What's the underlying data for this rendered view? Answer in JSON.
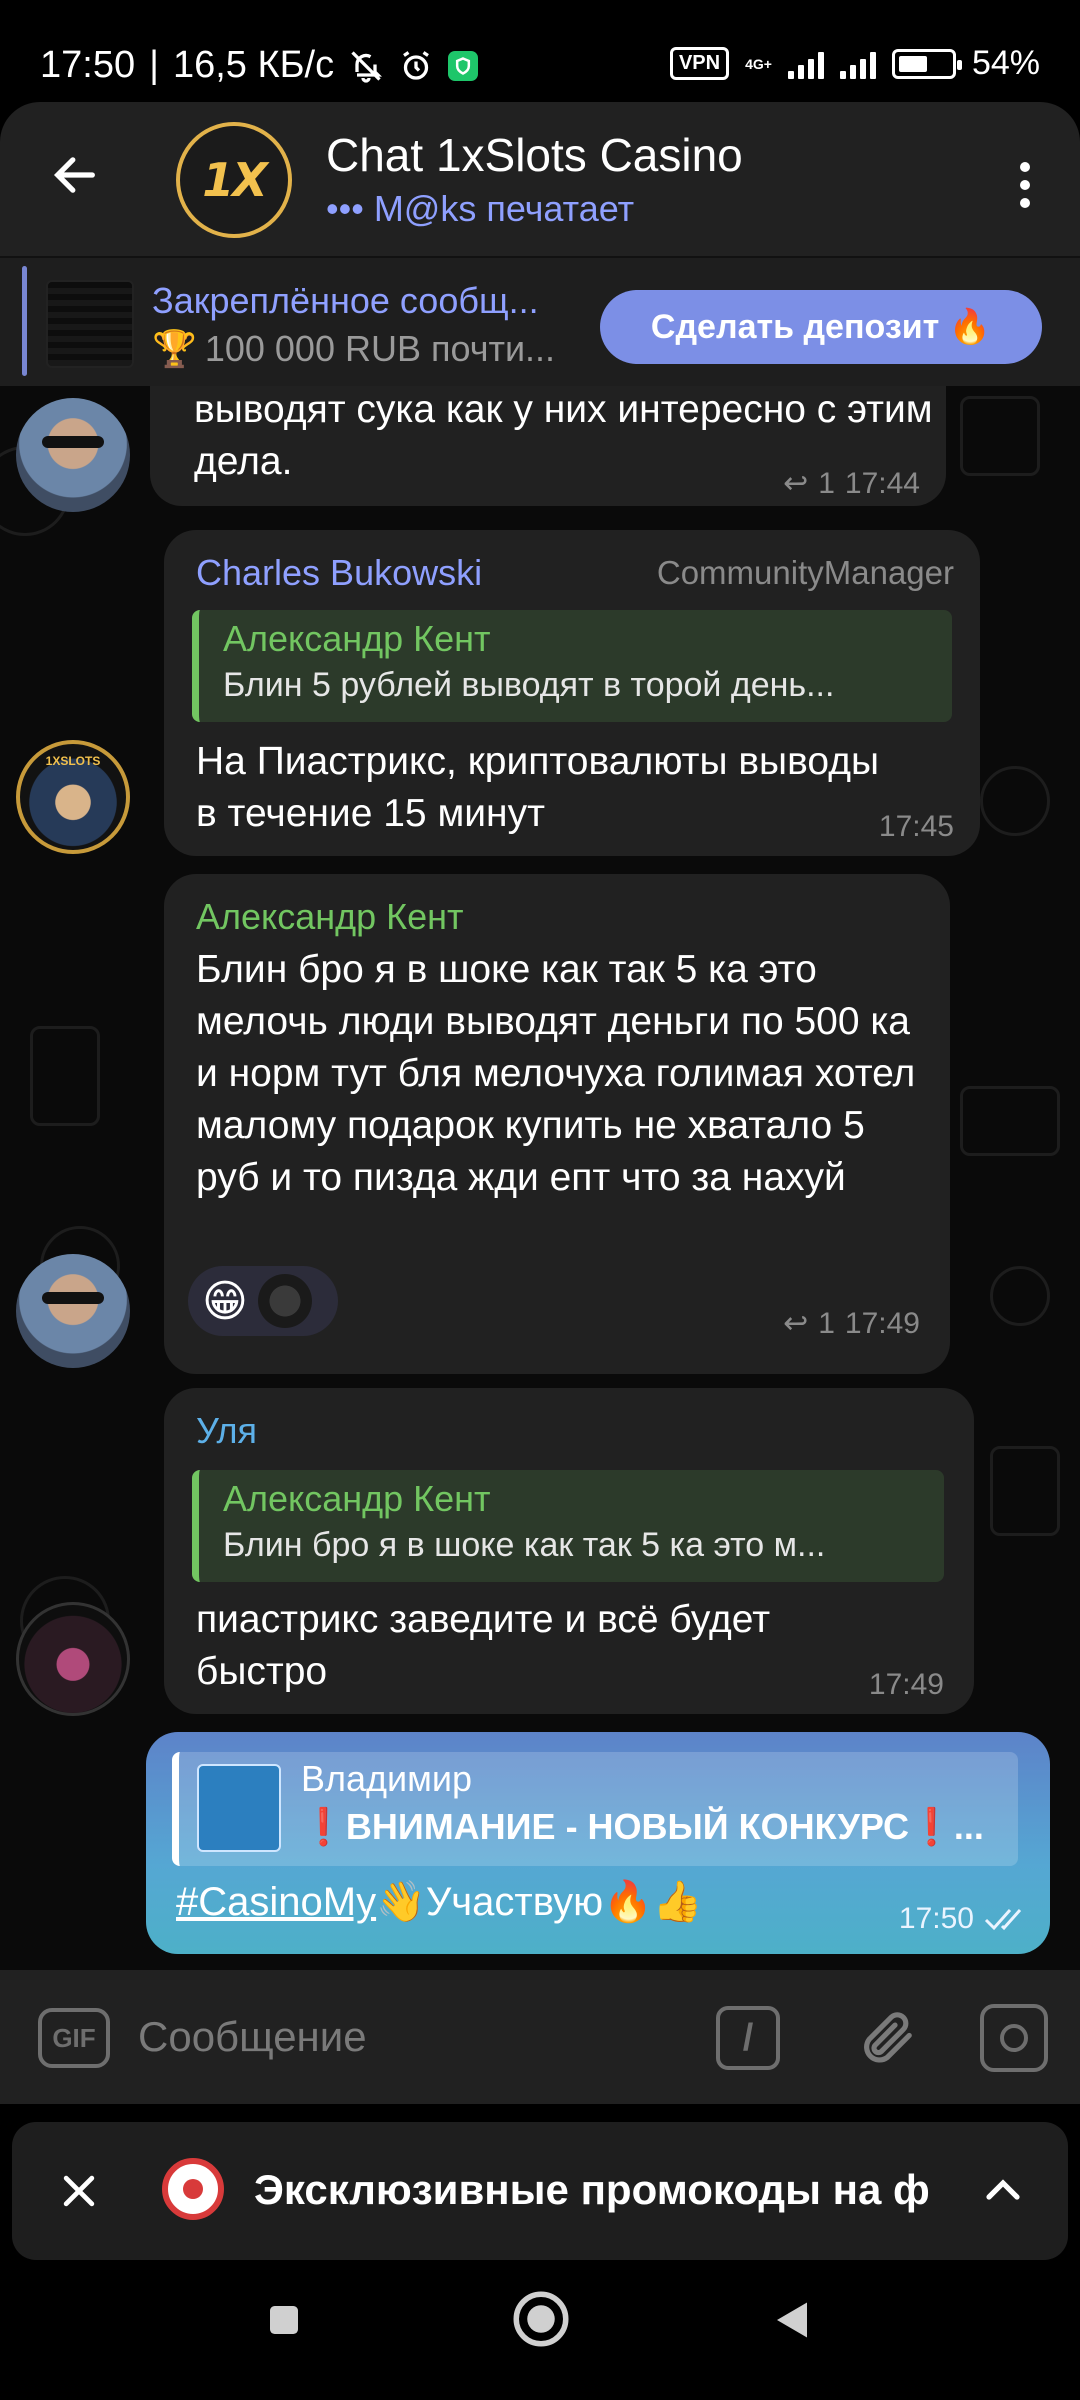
{
  "status_bar": {
    "time": "17:50",
    "separator": "|",
    "net_speed": "16,5 КБ/с",
    "vpn": "VPN",
    "network_type": "4G+",
    "battery": "54%",
    "battery_level": 0.54,
    "icons": [
      "bell-off-icon",
      "alarm-icon",
      "vpn-shield-icon"
    ]
  },
  "header": {
    "avatar_logo": "1X",
    "title": "Chat 1xSlots Casino",
    "typing_dots": "•••",
    "typing_text": "M@ks печатает"
  },
  "pinned": {
    "title": "Закреплённое сообщ...",
    "text_icon": "🏆",
    "text": "100 000 RUB почти...",
    "button_label": "Сделать депозит 🔥"
  },
  "messages": [
    {
      "text": "выводят сука как у них интересно с этим дела.",
      "replies": "1",
      "time": "17:44"
    },
    {
      "sender": "Charles Bukowski",
      "role": "CommunityManager",
      "reply_to_name": "Александр Кент",
      "reply_to_text": "Блин 5 рублей выводят в торой день...",
      "text": "На Пиастрикс, криптовалюты выводы в течение 15 минут",
      "time": "17:45",
      "avatar_text": "1XSLOTS"
    },
    {
      "sender": "Александр Кент",
      "text": "Блин бро я в шоке как так 5 ка это мелочь люди выводят деньги по 500 ка и норм тут бля мелочуха голимая хотел малому подарок купить не хватало 5 руб и то пизда жди епт что за нахуй",
      "reaction": "😁",
      "replies": "1",
      "time": "17:49"
    },
    {
      "sender": "Уля",
      "reply_to_name": "Александр Кент",
      "reply_to_text": "Блин бро я в шоке как так 5 ка это м...",
      "text": "пиастрикс заведите и всё будет быстро",
      "time": "17:49"
    },
    {
      "reply_to_name": "Владимир",
      "reply_to_text": "❗ВНИМАНИЕ - НОВЫЙ КОНКУРС❗...",
      "hashtag": "#CasinoMy",
      "text": "👋Участвую🔥👍",
      "time": "17:50",
      "status": "read"
    }
  ],
  "input": {
    "gif_label": "GIF",
    "placeholder": "Сообщение",
    "command_label": "/"
  },
  "promo": {
    "text": "Эксклюзивные промокоды на ф"
  },
  "colors": {
    "accent": "#8fa0ff",
    "button": "#7c8fe6",
    "reply_green": "#72c661",
    "bubble": "#212121",
    "outgoing_bubble": "#5aa0c8"
  }
}
